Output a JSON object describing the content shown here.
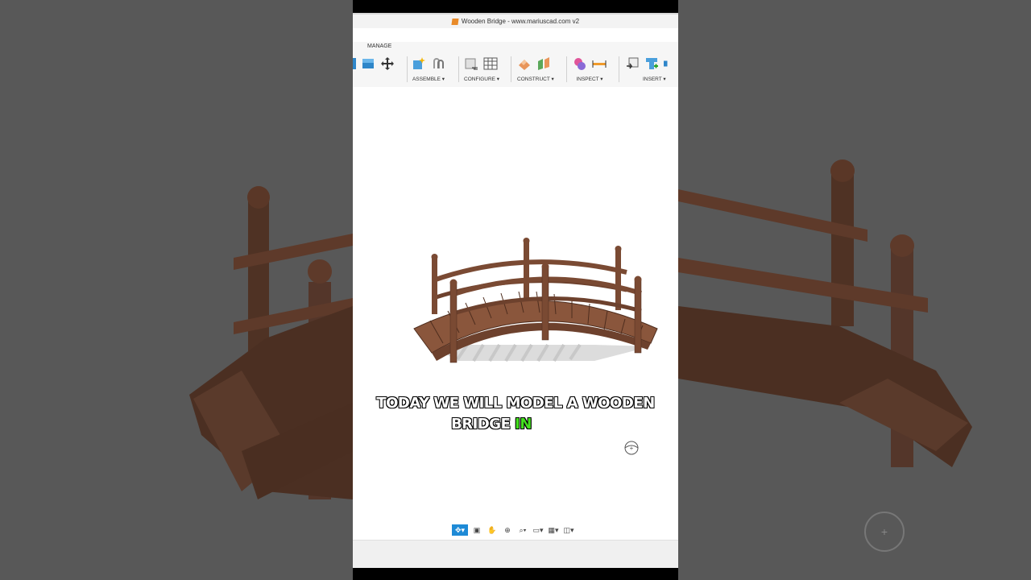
{
  "window": {
    "title": "Wooden Bridge - www.mariuscad.com v2"
  },
  "ribbon": {
    "manage_label": "MANAGE",
    "groups": [
      {
        "label": "ASSEMBLE ▾"
      },
      {
        "label": "CONFIGURE ▾"
      },
      {
        "label": "CONSTRUCT ▾"
      },
      {
        "label": "INSPECT ▾"
      },
      {
        "label": "INSERT ▾"
      }
    ]
  },
  "caption": {
    "line1": "TODAY WE WILL MODEL A WOODEN",
    "line2_main": "BRIDGE ",
    "line2_highlight": "IN"
  },
  "navbar": {
    "items": [
      "orbit-icon",
      "look-at-icon",
      "pan-icon",
      "zoom-icon",
      "fit-icon",
      "display-settings-icon",
      "grid-icon",
      "viewports-icon"
    ]
  },
  "colors": {
    "wood": "#7a4a33",
    "wood_dark": "#4e2d1e",
    "highlight": "#44e01f",
    "active_tool": "#1e8ad6"
  }
}
